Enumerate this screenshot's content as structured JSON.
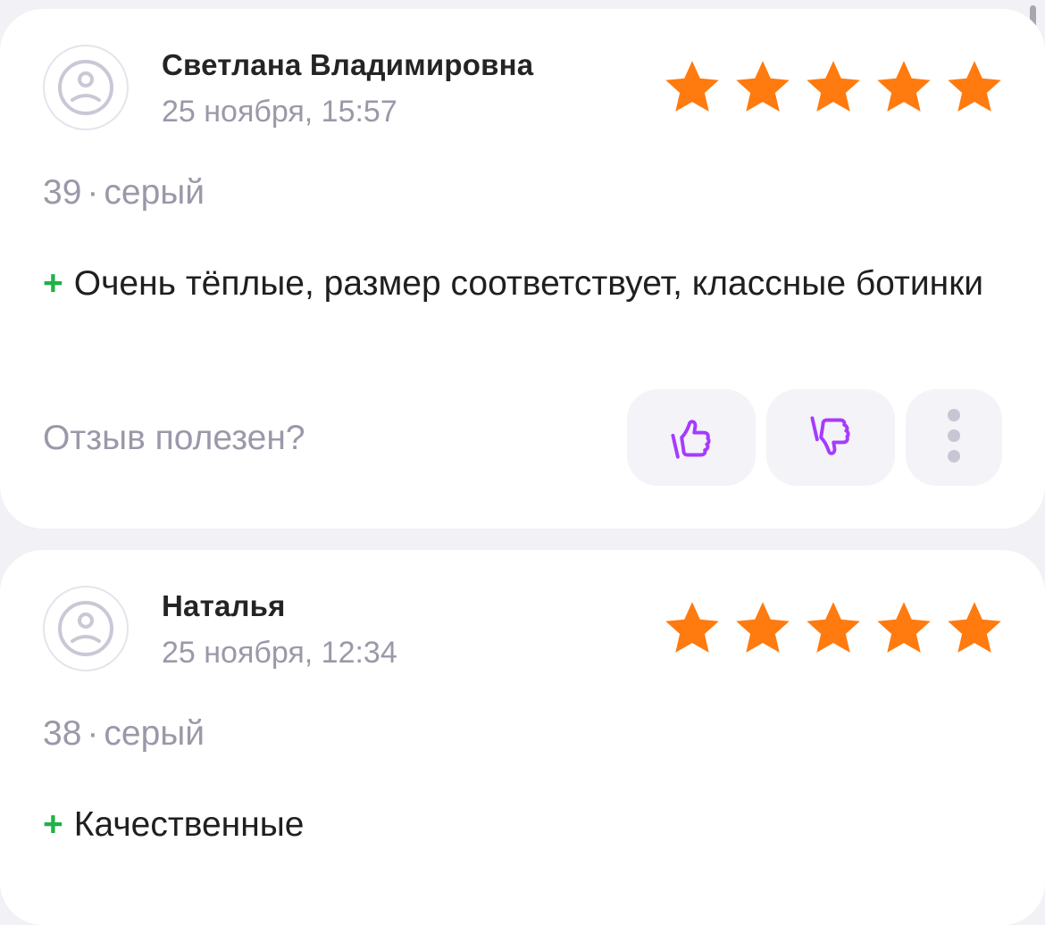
{
  "colors": {
    "star": "#FF7A0F",
    "accent_purple": "#A73AFD",
    "plus_green": "#21B14A",
    "muted_text": "#9A99A9",
    "background": "#F1F1F6"
  },
  "reviews": [
    {
      "author": "Светлана Владимировна",
      "date": "25 ноября, 15:57",
      "rating": 5,
      "size": "39",
      "separator": "·",
      "color": "серый",
      "plus_sign": "+",
      "text": "Очень тёплые, размер соответствует, классные ботинки",
      "helpful_question": "Отзыв полезен?",
      "actions": [
        "thumbs-up-icon",
        "thumbs-down-icon",
        "more-vertical-icon"
      ]
    },
    {
      "author": "Наталья",
      "date": "25 ноября, 12:34",
      "rating": 5,
      "size": "38",
      "separator": "·",
      "color": "серый",
      "plus_sign": "+",
      "text": "Качественные"
    }
  ]
}
